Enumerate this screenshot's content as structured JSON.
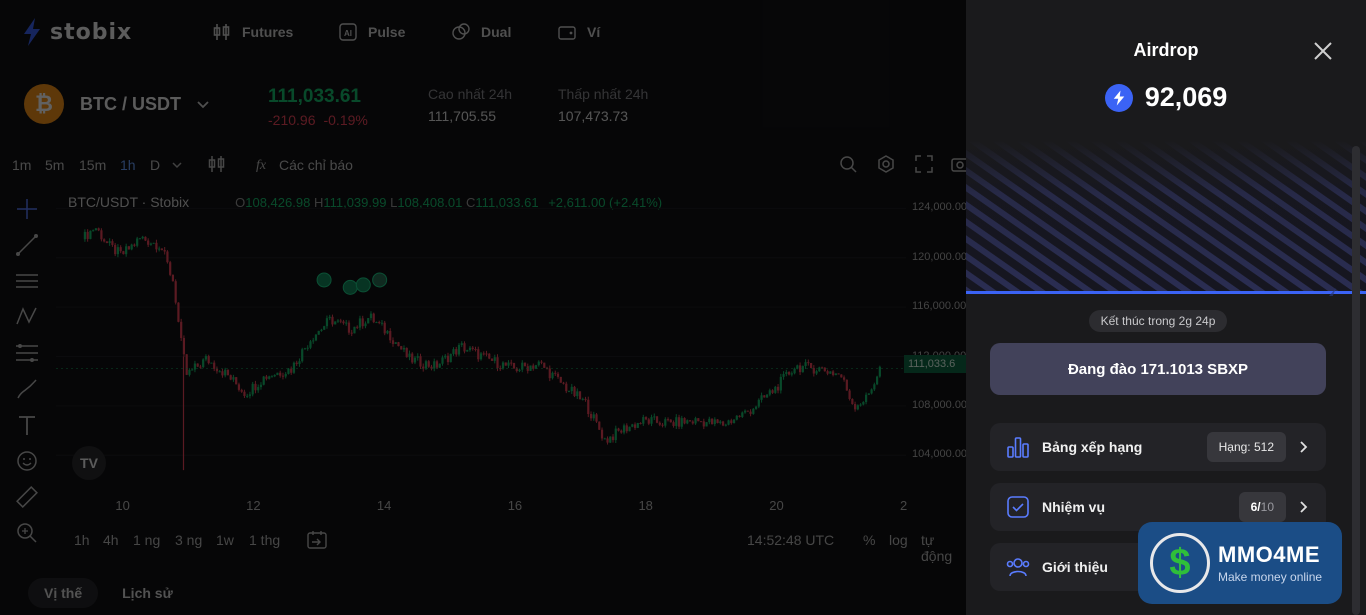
{
  "topnav": {
    "logo": "stobix",
    "items": [
      {
        "label": "Futures",
        "icon": "candles-icon"
      },
      {
        "label": "Pulse",
        "icon": "ai-icon"
      },
      {
        "label": "Dual",
        "icon": "coins-icon"
      },
      {
        "label": "Ví",
        "icon": "wallet-icon"
      }
    ]
  },
  "market": {
    "coin_letter": "₿",
    "pair": "BTC / USDT",
    "last_price": "111,033.61",
    "change_abs": "-210.96",
    "change_pct": "-0.19%",
    "high_label": "Cao nhất 24h",
    "high_value": "111,705.55",
    "low_label": "Thấp nhất 24h",
    "low_value": "107,473.73"
  },
  "toolbar": {
    "timeframes": [
      "1m",
      "5m",
      "15m",
      "1h",
      "D"
    ],
    "active_timeframe": "1h",
    "indicators": "Các chỉ báo"
  },
  "legend": {
    "symbol": "BTC/USDT · Stobix",
    "o_label": "O",
    "o": "108,426.98",
    "h_label": "H",
    "h": "111,039.99",
    "l_label": "L",
    "l": "108,408.01",
    "c_label": "C",
    "c": "111,033.61",
    "change": "+2,611.00 (+2.41%)"
  },
  "chart_data": {
    "type": "candlestick",
    "title": "BTC/USDT · Stobix",
    "y_ticks": [
      "124,000.00",
      "120,000.00",
      "116,000.00",
      "112,000.00",
      "108,000.00",
      "104,000.00"
    ],
    "x_ticks": [
      "10",
      "12",
      "14",
      "16",
      "18",
      "20",
      "2"
    ],
    "ylim": [
      102000,
      125000
    ],
    "last_value_label": "111,033.6",
    "close_path": [
      {
        "x": 9.4,
        "y": 121500
      },
      {
        "x": 9.6,
        "y": 122500
      },
      {
        "x": 9.8,
        "y": 121000
      },
      {
        "x": 10.0,
        "y": 120200
      },
      {
        "x": 10.3,
        "y": 121600
      },
      {
        "x": 10.6,
        "y": 121000
      },
      {
        "x": 10.8,
        "y": 118000
      },
      {
        "x": 10.9,
        "y": 113500
      },
      {
        "x": 11.0,
        "y": 110500
      },
      {
        "x": 11.3,
        "y": 111800
      },
      {
        "x": 11.6,
        "y": 110600
      },
      {
        "x": 11.9,
        "y": 109000
      },
      {
        "x": 12.2,
        "y": 110400
      },
      {
        "x": 12.6,
        "y": 111000
      },
      {
        "x": 12.9,
        "y": 113500
      },
      {
        "x": 13.2,
        "y": 115000
      },
      {
        "x": 13.5,
        "y": 114200
      },
      {
        "x": 13.8,
        "y": 115200
      },
      {
        "x": 14.1,
        "y": 113800
      },
      {
        "x": 14.4,
        "y": 111800
      },
      {
        "x": 14.8,
        "y": 111200
      },
      {
        "x": 15.2,
        "y": 112800
      },
      {
        "x": 15.6,
        "y": 111800
      },
      {
        "x": 16.0,
        "y": 111000
      },
      {
        "x": 16.4,
        "y": 111400
      },
      {
        "x": 16.8,
        "y": 109500
      },
      {
        "x": 17.1,
        "y": 108200
      },
      {
        "x": 17.4,
        "y": 105200
      },
      {
        "x": 17.7,
        "y": 106200
      },
      {
        "x": 18.0,
        "y": 106800
      },
      {
        "x": 18.4,
        "y": 106600
      },
      {
        "x": 18.8,
        "y": 106800
      },
      {
        "x": 19.2,
        "y": 106500
      },
      {
        "x": 19.6,
        "y": 107600
      },
      {
        "x": 20.0,
        "y": 109400
      },
      {
        "x": 20.3,
        "y": 111200
      },
      {
        "x": 20.7,
        "y": 111000
      },
      {
        "x": 21.0,
        "y": 110500
      },
      {
        "x": 21.2,
        "y": 108000
      },
      {
        "x": 21.4,
        "y": 108600
      },
      {
        "x": 21.6,
        "y": 111000
      }
    ]
  },
  "bottombar": {
    "ranges": [
      "1h",
      "4h",
      "1 ng",
      "3 ng",
      "1w",
      "1 thg"
    ],
    "time": "14:52:48 UTC",
    "percent": "%",
    "log": "log",
    "auto": "tự động"
  },
  "position_tabs": {
    "positions": "Vị thế",
    "history": "Lịch sử"
  },
  "airdrop": {
    "title": "Airdrop",
    "balance": "92,069",
    "ends_in": "Kết thúc trong 2g 24p",
    "mining_button": "Đang đào 171.1013 SBXP",
    "leaderboard": {
      "label": "Bảng xếp hạng",
      "badge": "Hạng: 512"
    },
    "tasks": {
      "label": "Nhiệm vụ",
      "done": "6",
      "sep": "/",
      "total": "10"
    },
    "referral": {
      "label": "Giới thiệu"
    }
  },
  "watermark": {
    "brand": "MMO4ME",
    "tagline": "Make money online"
  },
  "colors": {
    "up": "#17c06e",
    "down": "#f0465a",
    "accent": "#3b63f5",
    "panel": "#1a1a1c"
  }
}
